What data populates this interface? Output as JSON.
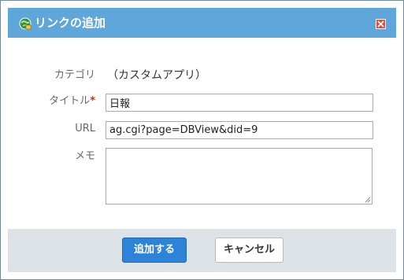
{
  "dialog": {
    "title": "リンクの追加",
    "title_icon": "link-globe-icon",
    "close_icon": "close-icon"
  },
  "form": {
    "category_label": "カテゴリ",
    "category_value": "（カスタムアプリ）",
    "title_label": "タイトル",
    "required_mark": "*",
    "title_value": "日報",
    "url_label": "URL",
    "url_value": "ag.cgi?page=DBView&did=9",
    "memo_label": "メモ",
    "memo_value": ""
  },
  "footer": {
    "add_button": "追加する",
    "cancel_button": "キャンセル"
  },
  "colors": {
    "title_bar": "#5fa7db",
    "primary_button": "#2d83d7",
    "close_button": "#e84a33",
    "footer": "#dde2e6"
  }
}
